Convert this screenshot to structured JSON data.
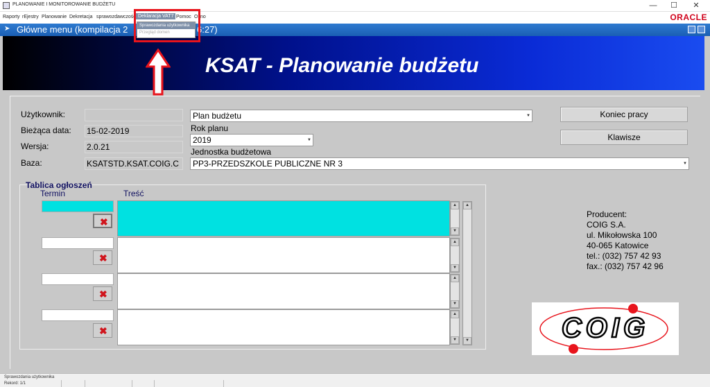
{
  "window": {
    "title": "PLANOWANIE I MONITOROWANIE BUDŻETU",
    "minimize": "—",
    "maximize": "☐",
    "close": "✕"
  },
  "menubar": {
    "items": [
      "Raporty",
      "rEjestry",
      "Planowanie",
      "Dekretacja",
      "sprawozdawczość",
      "Deklaracja VAT7",
      "Pomoc",
      "Okno"
    ],
    "brand": "ORACLE"
  },
  "dropdown": {
    "items": [
      "Sprawozdania użytkownika",
      "Przegląd domen"
    ]
  },
  "form_header": {
    "title": "Główne menu (kompilacja 2",
    "title_tail": "6:27)"
  },
  "banner": {
    "title": "KSAT - Planowanie budżetu"
  },
  "info": {
    "user_label": "Użytkownik:",
    "user_value": "",
    "date_label": "Bieżąca data:",
    "date_value": "15-02-2019",
    "version_label": "Wersja:",
    "version_value": "2.0.21",
    "db_label": "Baza:",
    "db_value": "KSATSTD.KSAT.COIG.C"
  },
  "selectors": {
    "plan_value": "Plan budżetu",
    "year_label": "Rok planu",
    "year_value": "2019",
    "unit_label": "Jednostka budżetowa",
    "unit_value": "PP3-PRZEDSZKOLE PUBLICZNE NR 3"
  },
  "buttons": {
    "exit": "Koniec pracy",
    "keys": "Klawisze"
  },
  "board": {
    "title": "Tablica ogłoszeń",
    "col_date": "Termin",
    "col_content": "Treść"
  },
  "producer": {
    "l1": "Producent:",
    "l2": "COIG S.A.",
    "l3": "ul. Mikołowska 100",
    "l4": "40-065 Katowice",
    "l5": "tel.: (032) 757 42 93",
    "l6": "fax.: (032) 757 42 96"
  },
  "logo": {
    "text": "COIG"
  },
  "status": {
    "message": "Sprawozdania użytkownika",
    "record": "Rekord: 1/1"
  },
  "colors": {
    "header_blue": "#1a5fb4",
    "highlight_red": "#e8141c",
    "cyan": "#00e1e1",
    "form_gray": "#c8c8c8"
  }
}
